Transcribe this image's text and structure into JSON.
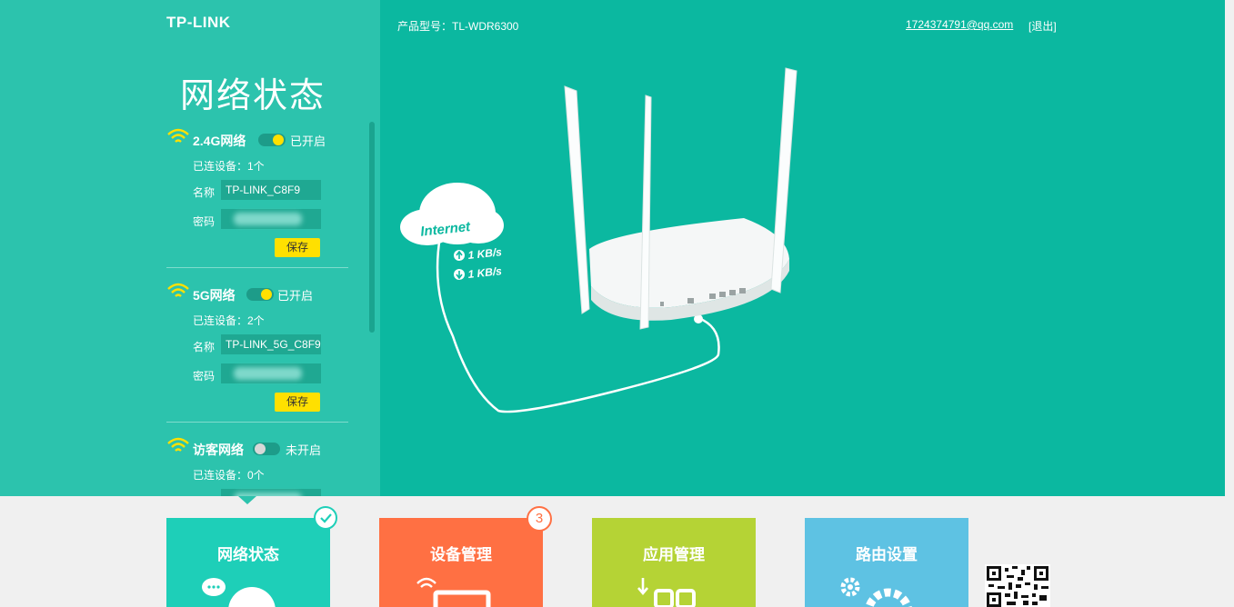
{
  "header": {
    "logo": "TP-LINK",
    "model": "产品型号：TL-WDR6300",
    "account": "1724374791@qq.com",
    "logout": "[退出]"
  },
  "sidebar": {
    "title": "网络状态",
    "networks": [
      {
        "name": "2.4G网络",
        "enabled": true,
        "status": "已开启",
        "devices": "已连设备：1个",
        "ssid_label": "名称",
        "ssid": "TP-LINK_C8F9",
        "password_label": "密码",
        "save": "保存"
      },
      {
        "name": "5G网络",
        "enabled": true,
        "status": "已开启",
        "devices": "已连设备：2个",
        "ssid_label": "名称",
        "ssid": "TP-LINK_5G_C8F9",
        "password_label": "密码",
        "save": "保存"
      },
      {
        "name": "访客网络",
        "enabled": false,
        "status": "未开启",
        "devices": "已连设备：0个"
      }
    ]
  },
  "diagram": {
    "internet": "Internet",
    "upload": "1 KB/s",
    "download": "1 KB/s"
  },
  "nav": [
    {
      "label": "网络状态",
      "active": true
    },
    {
      "label": "设备管理",
      "badge": "3"
    },
    {
      "label": "应用管理"
    },
    {
      "label": "路由设置"
    }
  ],
  "colors": {
    "accent": "#0bb8a0",
    "toggle_on": "#ffe000",
    "card_status": "#1ecfb8",
    "card_devices": "#ff7043",
    "card_apps": "#b5d335",
    "card_settings": "#5ec2e3"
  }
}
